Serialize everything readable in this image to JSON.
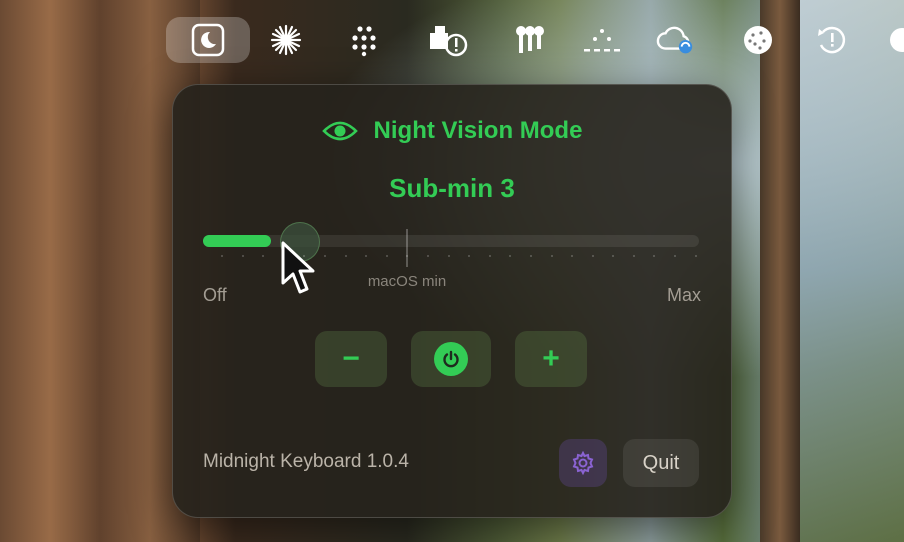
{
  "menubar": {
    "icons": [
      "moon-icon",
      "starburst-icon",
      "dots-grid-icon",
      "package-alert-icon",
      "keys-icon",
      "dots-dashed-icon",
      "cloud-sync-icon",
      "cookie-icon",
      "clock-alert-icon",
      "circle-partial-icon"
    ]
  },
  "panel": {
    "title": "Night Vision Mode",
    "level_label": "Sub-min 3",
    "slider": {
      "value_fraction": 0.13,
      "marker_label": "macOS min",
      "min_label": "Off",
      "max_label": "Max"
    },
    "controls": {
      "decrease_label": "−",
      "increase_label": "+"
    },
    "version": "Midnight Keyboard 1.0.4",
    "quit_label": "Quit"
  },
  "colors": {
    "accent": "#33cc55",
    "panel_bg": "#26221c",
    "settings_accent": "#8a63d2"
  }
}
